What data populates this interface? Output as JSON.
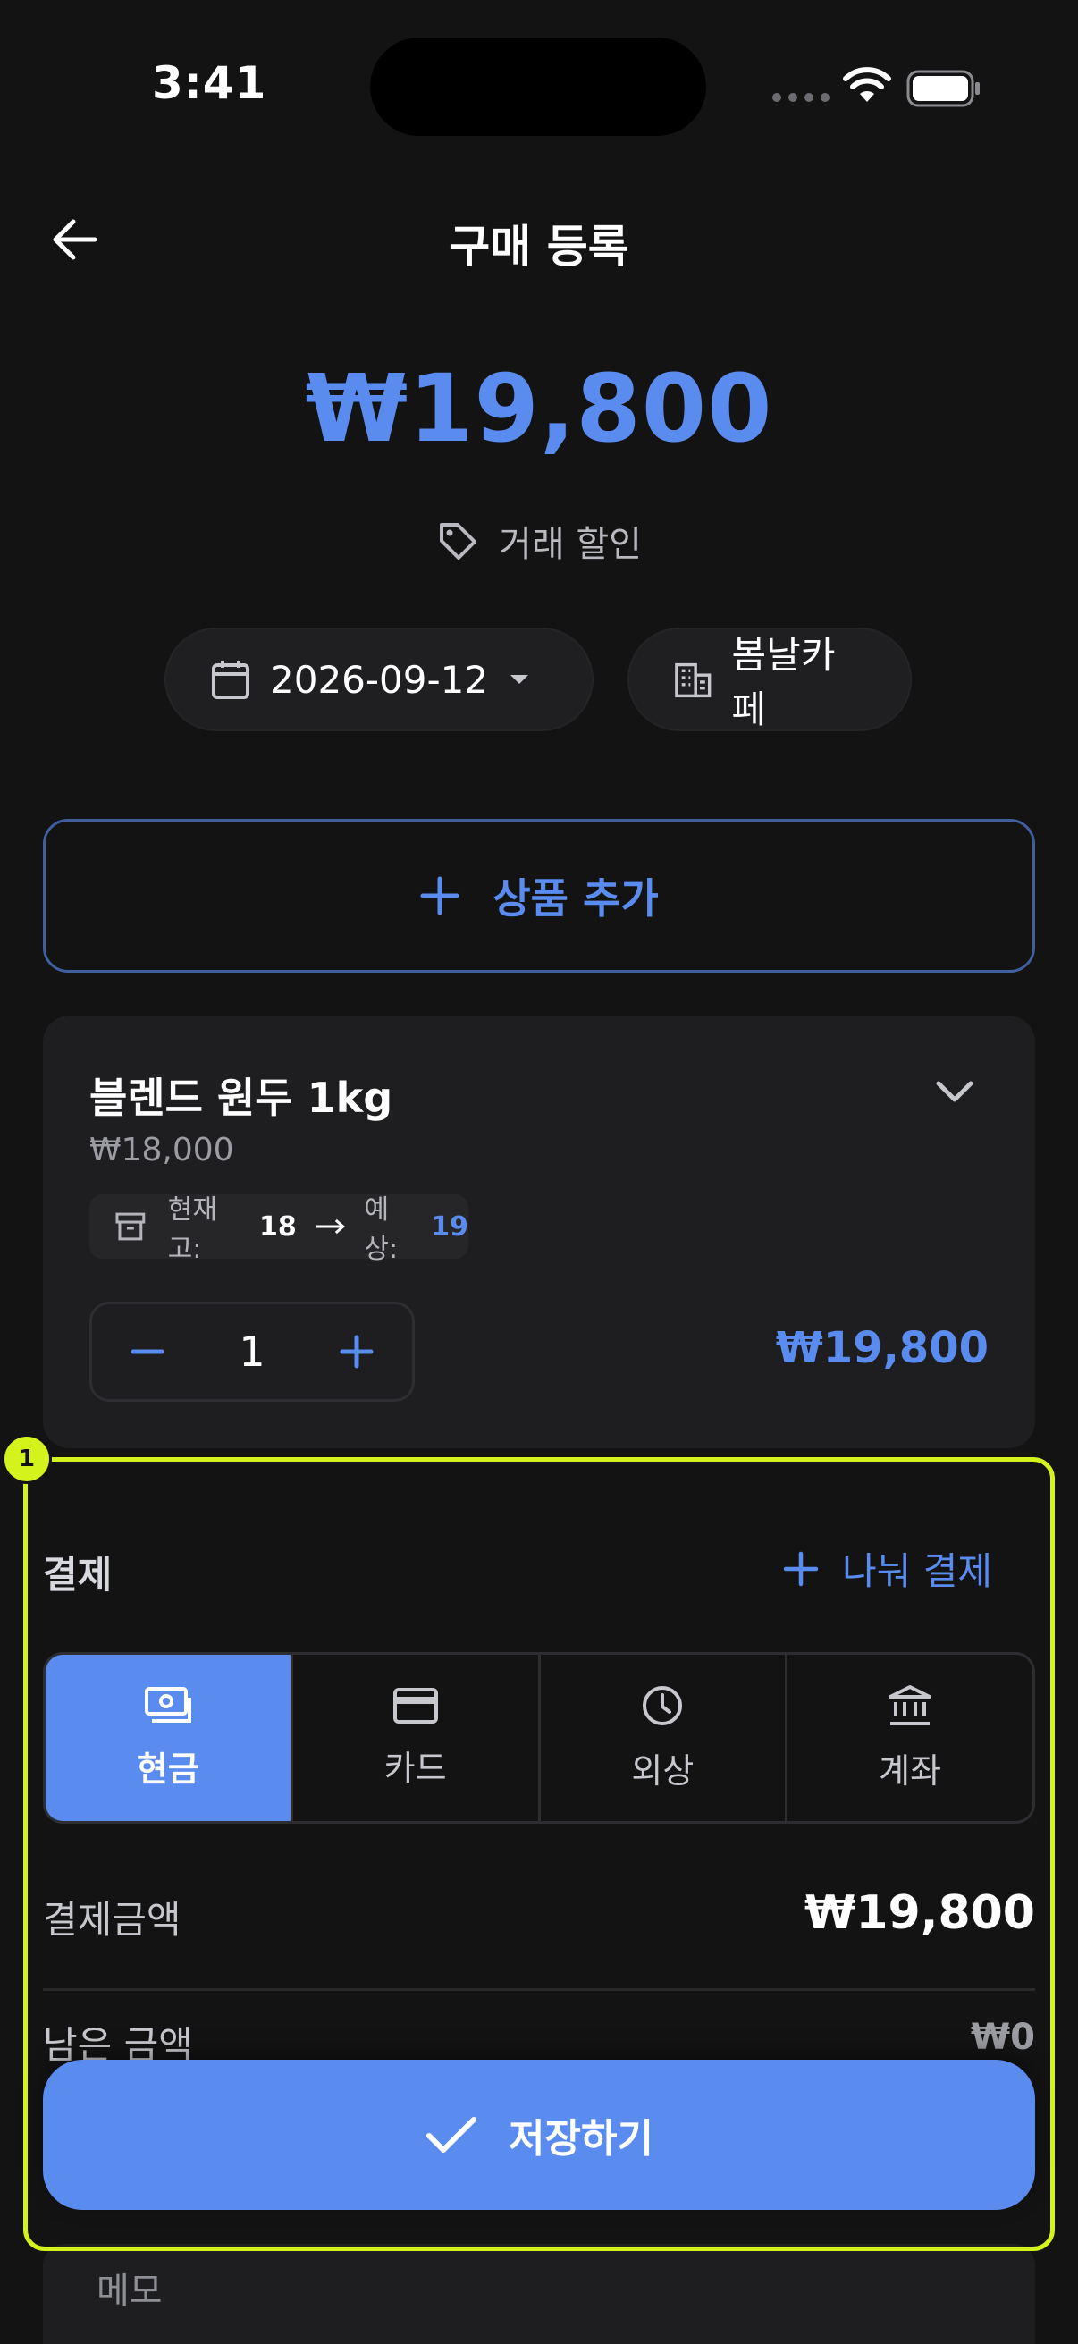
{
  "status_bar": {
    "time": "3:41"
  },
  "header": {
    "title": "구매 등록"
  },
  "summary": {
    "total_amount": "₩19,800",
    "discount_label": "거래 할인"
  },
  "chips": {
    "date": "2026-09-12",
    "store": "봄날카페"
  },
  "add_product": {
    "label": "상품 추가"
  },
  "product": {
    "name": "블렌드 원두 1kg",
    "unit_price": "₩18,000",
    "stock_label": "현재고:",
    "stock_current": "18",
    "stock_expected_label": "예상:",
    "stock_expected": "19",
    "quantity": "1",
    "line_total": "₩19,800"
  },
  "payment": {
    "title": "결제",
    "split_label": "나눠 결제",
    "methods": [
      {
        "label": "현금",
        "icon": "cash-icon",
        "active": true
      },
      {
        "label": "카드",
        "icon": "card-icon",
        "active": false
      },
      {
        "label": "외상",
        "icon": "clock-icon",
        "active": false
      },
      {
        "label": "계좌",
        "icon": "bank-icon",
        "active": false
      }
    ],
    "amount_label": "결제금액",
    "amount": "₩19,800",
    "remaining_label": "남은 금액",
    "remaining": "₩0"
  },
  "memo": {
    "placeholder": "메모"
  },
  "save": {
    "label": "저장하기"
  },
  "annotation": {
    "marker": "1"
  },
  "colors": {
    "accent": "#5a8cf0",
    "background": "#131314",
    "card": "#1e1e20",
    "highlight": "#d4f21c"
  }
}
